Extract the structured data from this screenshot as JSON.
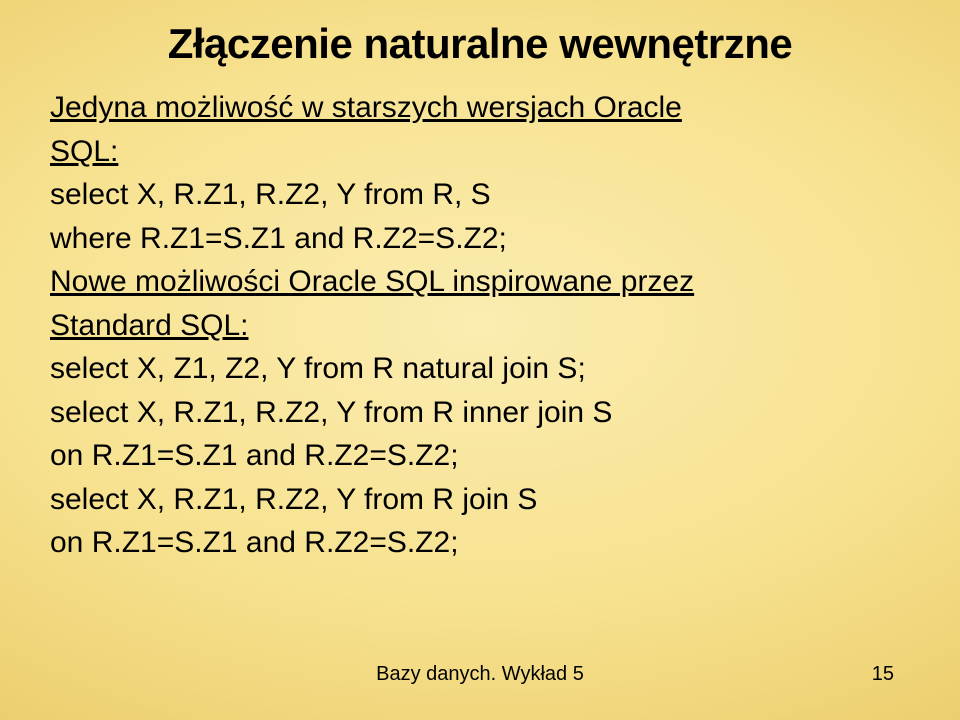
{
  "title": "Złączenie naturalne wewnętrzne",
  "lead1a": "Jedyna możliwość w starszych wersjach Oracle",
  "lead1b": "SQL:",
  "code1a": "select X, R.Z1, R.Z2, Y from R, S",
  "code1b": "where R.Z1=S.Z1 and R.Z2=S.Z2;",
  "lead2a": "Nowe możliwości Oracle SQL inspirowane przez",
  "lead2b": "Standard SQL:",
  "code2": "select X, Z1, Z2, Y from R natural join S;",
  "code3a": "select X, R.Z1, R.Z2, Y from R inner join S",
  "code3b": "on R.Z1=S.Z1 and R.Z2=S.Z2;",
  "code4a": "select X, R.Z1, R.Z2, Y from R join S",
  "code4b": "on R.Z1=S.Z1 and R.Z2=S.Z2;",
  "footer_text": "Bazy danych. Wykład 5",
  "page_number": "15"
}
